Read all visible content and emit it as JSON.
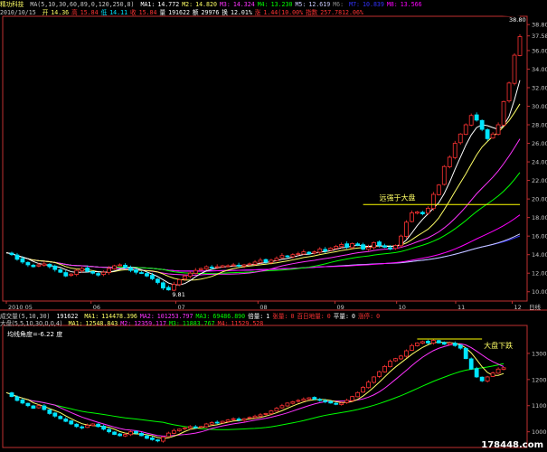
{
  "colors": {
    "up": "#ff3333",
    "down": "#00e5ff",
    "axis": "#c03030",
    "grid": "#3a0000",
    "text": "#c8c8c8",
    "ma5": "#ffffff",
    "ma10": "#ffff66",
    "ma20": "#ff33ff",
    "ma30": "#00ff00",
    "ma60": "#ccccff",
    "ma120": "#3333ff",
    "ma250": "#ff00ff",
    "ma30b": "#ffff00"
  },
  "top": {
    "line1": {
      "name": "精功科技",
      "ma_label": "MA(5,10,30,60,89,0,120,250,8)",
      "items": [
        [
          "MA1:",
          "14.772",
          "#ffffff"
        ],
        [
          "M2:",
          "14.820",
          "#ffff66"
        ],
        [
          "M3:",
          "14.324",
          "#ff33ff"
        ],
        [
          "M4:",
          "13.230",
          "#00ff00"
        ],
        [
          "M5:",
          "12.619",
          "#ccccff"
        ],
        [
          "M6:",
          "",
          "#888"
        ],
        [
          "M7:",
          "10.839",
          "#3333ff"
        ],
        [
          "M8:",
          "13.566",
          "#ff00ff"
        ]
      ]
    },
    "line2": {
      "date": "2010/10/15",
      "items": [
        [
          "开",
          "14.36",
          "#ffff66"
        ],
        [
          "高",
          "15.84",
          "#ff3333"
        ],
        [
          "低",
          "14.11",
          "#00e5ff"
        ],
        [
          "收",
          "15.84",
          "#ff3333"
        ],
        [
          "量",
          "191622",
          "#ffffff"
        ],
        [
          "额",
          "29976",
          "#ffffff"
        ],
        [
          "换",
          "12.01%",
          "#ffffff"
        ],
        [
          "涨",
          "1.44(10.00%",
          "#ff3333"
        ],
        [
          "指数",
          "257.7812.06%",
          "#ff3333"
        ]
      ]
    }
  },
  "price_axis": [
    "38.80",
    "37.58",
    "36.00",
    "34.00",
    "32.00",
    "30.00",
    "28.00",
    "26.00",
    "24.00",
    "22.00",
    "20.00",
    "18.00",
    "16.00",
    "14.00",
    "12.00",
    "10.00"
  ],
  "month_labels": [
    "2010 05",
    "06",
    "07",
    "08",
    "09",
    "10",
    "11",
    "12"
  ],
  "date_label": "日线",
  "annotations": {
    "low_price": "9.81",
    "high_price": "38.80",
    "strong": "远强于大盘",
    "weak": "大盘下跌"
  },
  "volume_line": {
    "label": "成交量(5,10,30)",
    "value": "191622",
    "items": [
      [
        "MA1:",
        "114478.396",
        "#ffff66"
      ],
      [
        "MA2:",
        "101253.797",
        "#ff33ff"
      ],
      [
        "MA3:",
        "69486.890",
        "#00ff00"
      ],
      [
        "倍量:",
        "1",
        "#ffffff"
      ],
      [
        "张量:",
        "0",
        "#ff3333"
      ],
      [
        "百日地量:",
        "0",
        "#ff3333"
      ],
      [
        "平量:",
        "0",
        "#ffffff"
      ],
      [
        "涨停:",
        "0",
        "#ff3333"
      ]
    ]
  },
  "index_line": {
    "label": "大盘(5,5,10,30,0,0,4)",
    "items": [
      [
        "MA1:",
        "12548.843",
        "#ffff66"
      ],
      [
        "M2:",
        "12359.117",
        "#ff33ff"
      ],
      [
        "M3:",
        "11883.767",
        "#00ff00"
      ],
      [
        "M4:",
        "11529.528",
        "#ff3333"
      ]
    ]
  },
  "index_axis": [
    "13000",
    "12000",
    "11000",
    "10000"
  ],
  "angle_text": "均线角度=-6.22 度",
  "watermark": "178448.com",
  "chart_data": {
    "type": "candlestick",
    "title": "精功科技",
    "x_range": [
      "2010-05",
      "2010-12"
    ],
    "price_ylim": [
      9,
      39.5
    ],
    "index_ylim": [
      9400,
      14000
    ],
    "price_series": [
      14.2,
      14.0,
      13.5,
      13.2,
      12.9,
      12.7,
      12.9,
      13.0,
      12.7,
      12.4,
      12.1,
      11.7,
      11.9,
      12.3,
      12.5,
      12.2,
      12.0,
      11.8,
      12.1,
      12.5,
      12.8,
      12.9,
      12.6,
      12.3,
      12.1,
      12.0,
      11.7,
      11.4,
      11.0,
      10.4,
      10.2,
      10.8,
      11.3,
      11.7,
      12.0,
      12.3,
      12.5,
      12.7,
      12.6,
      12.7,
      12.8,
      12.8,
      12.9,
      12.8,
      12.9,
      13.0,
      13.2,
      13.4,
      13.2,
      13.4,
      13.6,
      13.9,
      13.8,
      14.0,
      14.1,
      14.3,
      14.1,
      14.3,
      14.6,
      14.4,
      14.7,
      14.9,
      15.1,
      14.8,
      15.2,
      15.0,
      14.6,
      14.8,
      15.3,
      15.0,
      14.8,
      14.6,
      15.0,
      16.0,
      17.5,
      18.5,
      18.6,
      18.4,
      19.0,
      20.5,
      21.5,
      23.5,
      24.5,
      26.0,
      27.0,
      28.0,
      29.0,
      28.5,
      27.5,
      26.5,
      27.0,
      28.0,
      30.5,
      32.5,
      35.5,
      37.5
    ],
    "index_series": [
      11500,
      11350,
      11200,
      11100,
      11000,
      10900,
      11000,
      10850,
      10700,
      10600,
      10500,
      10400,
      10300,
      10200,
      10150,
      10250,
      10300,
      10200,
      10100,
      10000,
      9900,
      9850,
      9900,
      10000,
      9950,
      9850,
      9750,
      9700,
      9650,
      9800,
      9950,
      10050,
      10100,
      10150,
      10200,
      10150,
      10200,
      10300,
      10350,
      10350,
      10400,
      10450,
      10500,
      10450,
      10500,
      10550,
      10600,
      10650,
      10700,
      10800,
      10900,
      11000,
      11100,
      11150,
      11200,
      11250,
      11300,
      11250,
      11200,
      11150,
      11100,
      11050,
      11100,
      11200,
      11350,
      11500,
      11700,
      11900,
      12100,
      12300,
      12500,
      12700,
      12800,
      12900,
      13100,
      13300,
      13400,
      13450,
      13400,
      13500,
      13400,
      13350,
      13400,
      13300,
      13200,
      12800,
      12400,
      12100,
      11950,
      12100,
      12250,
      12400,
      12450
    ]
  }
}
